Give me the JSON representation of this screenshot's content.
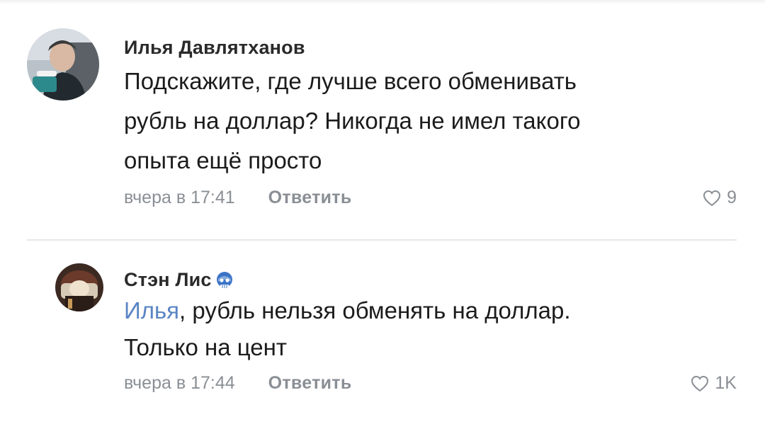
{
  "comments": [
    {
      "author": "Илья Давлятханов",
      "text": "Подскажите, где лучше всего обменивать\nрубль на доллар? Никогда не имел такого\nопыта ещё просто",
      "time": "вчера в 17:41",
      "reply_label": "Ответить",
      "likes": "9",
      "avatar_icon": "user-photo-avatar",
      "like_icon": "heart-outline-icon"
    },
    {
      "author": "Стэн Лис",
      "badge_icon": "skull-mask-emoji-icon",
      "mention": "Илья",
      "text": ", рубль нельзя обменять на доллар.\nТолько на цент",
      "time": "вчера в 17:44",
      "reply_label": "Ответить",
      "likes": "1K",
      "avatar_icon": "user-photo-avatar",
      "like_icon": "heart-outline-icon"
    }
  ],
  "colors": {
    "text": "#1c1c1c",
    "meta": "#8a8f95",
    "mention": "#5a85c4",
    "divider": "#e6e7ea"
  }
}
